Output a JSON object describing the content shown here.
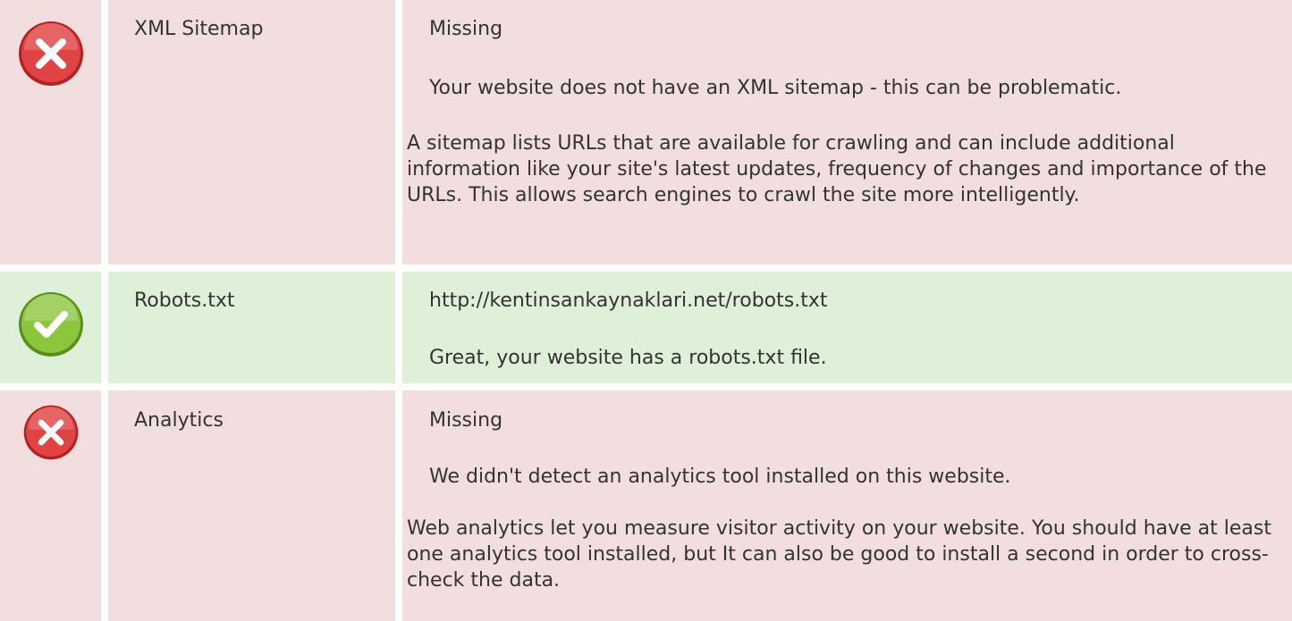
{
  "checks": [
    {
      "status": "fail",
      "icon": "error-x-icon",
      "name": "XML Sitemap",
      "value": "Missing",
      "message": "Your website does not have an XML sitemap - this can be problematic.",
      "explanation": "A sitemap lists URLs that are available for crawling and can include additional information like your site's latest updates, frequency of changes and importance of the URLs. This allows search engines to crawl the site more intelligently."
    },
    {
      "status": "pass",
      "icon": "success-check-icon",
      "name": "Robots.txt",
      "value": "http://kentinsankaynaklari.net/robots.txt",
      "message": "Great, your website has a robots.txt file."
    },
    {
      "status": "fail",
      "icon": "error-x-icon",
      "name": "Analytics",
      "value": "Missing",
      "message": "We didn't detect an analytics tool installed on this website.",
      "explanation": "Web analytics let you measure visitor activity on your website. You should have at least one analytics tool installed, but It can also be good to install a second in order to cross-check the data."
    }
  ],
  "colors": {
    "fail_bg": "#f2dede",
    "pass_bg": "#dff0d8",
    "fail_icon": "#e04343",
    "pass_icon": "#8cc63f",
    "text": "#333333"
  }
}
